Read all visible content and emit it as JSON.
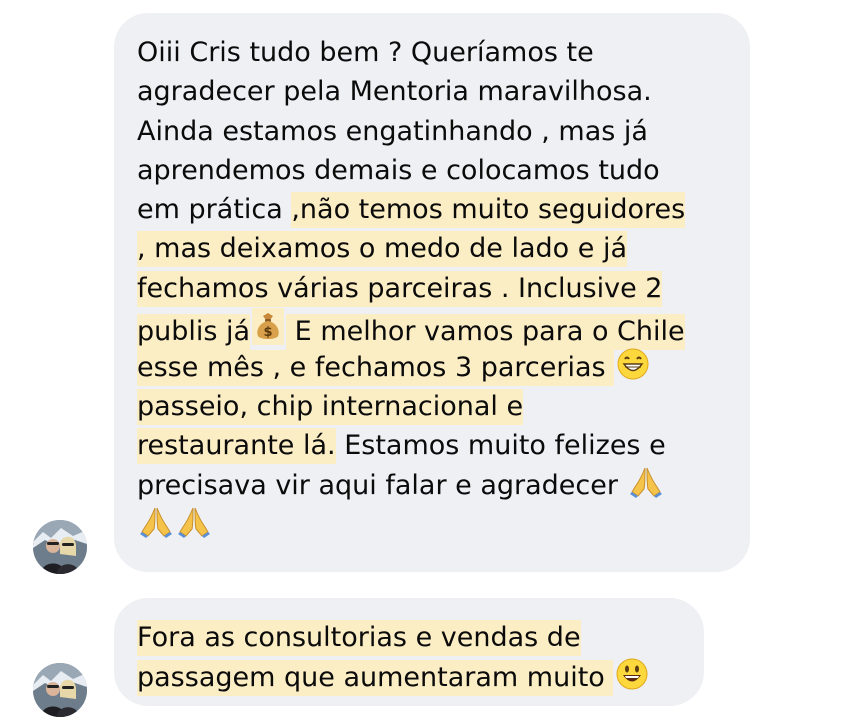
{
  "messages": [
    {
      "sender_avatar": "user-avatar",
      "lines": [
        [
          {
            "t": "Oiii Cris tudo bem ? Queríamos te",
            "h": false
          }
        ],
        [
          {
            "t": "agradecer pela Mentoria maravilhosa.",
            "h": false
          }
        ],
        [
          {
            "t": "Ainda estamos engatinhando , mas já",
            "h": false
          }
        ],
        [
          {
            "t": "aprendemos demais e colocamos tudo",
            "h": false
          }
        ],
        [
          {
            "t": "em prática ",
            "h": false
          },
          {
            "t": ",não temos muito seguidores",
            "h": true
          }
        ],
        [
          {
            "t": ", mas deixamos o medo de lado e já",
            "h": true
          }
        ],
        [
          {
            "t": "fechamos várias parceiras . Inclusive 2",
            "h": true
          }
        ],
        [
          {
            "t": "publis já",
            "h": true
          },
          {
            "e": "money-bag-emoji",
            "h": true
          },
          {
            "t": " E melhor vamos para o Chile",
            "h": true
          }
        ],
        [
          {
            "t": "esse mês , e fechamos 3 parcerias ",
            "h": true
          },
          {
            "e": "grinning-emoji",
            "h": false
          }
        ],
        [
          {
            "t": "passeio, chip internacional e",
            "h": true
          }
        ],
        [
          {
            "t": "restaurante lá.",
            "h": true
          },
          {
            "t": " Estamos muito felizes e",
            "h": false
          }
        ],
        [
          {
            "t": "precisava vir aqui falar e agradecer   ",
            "h": false
          },
          {
            "e": "praying-hands-emoji",
            "h": false
          }
        ],
        [
          {
            "e": "praying-hands-emoji",
            "h": false
          },
          {
            "e": "praying-hands-emoji",
            "h": false
          }
        ]
      ]
    },
    {
      "sender_avatar": "user-avatar",
      "lines": [
        [
          {
            "t": "Fora as consultorias e vendas de",
            "h": true
          }
        ],
        [
          {
            "t": "passagem que aumentaram muito ",
            "h": true
          },
          {
            "e": "smiley-emoji",
            "h": false
          }
        ]
      ]
    }
  ],
  "colors": {
    "bubble_bg": "#eff0f3",
    "highlight": "#fbedc4",
    "text": "#0b0b0b",
    "page_bg": "#ffffff"
  }
}
